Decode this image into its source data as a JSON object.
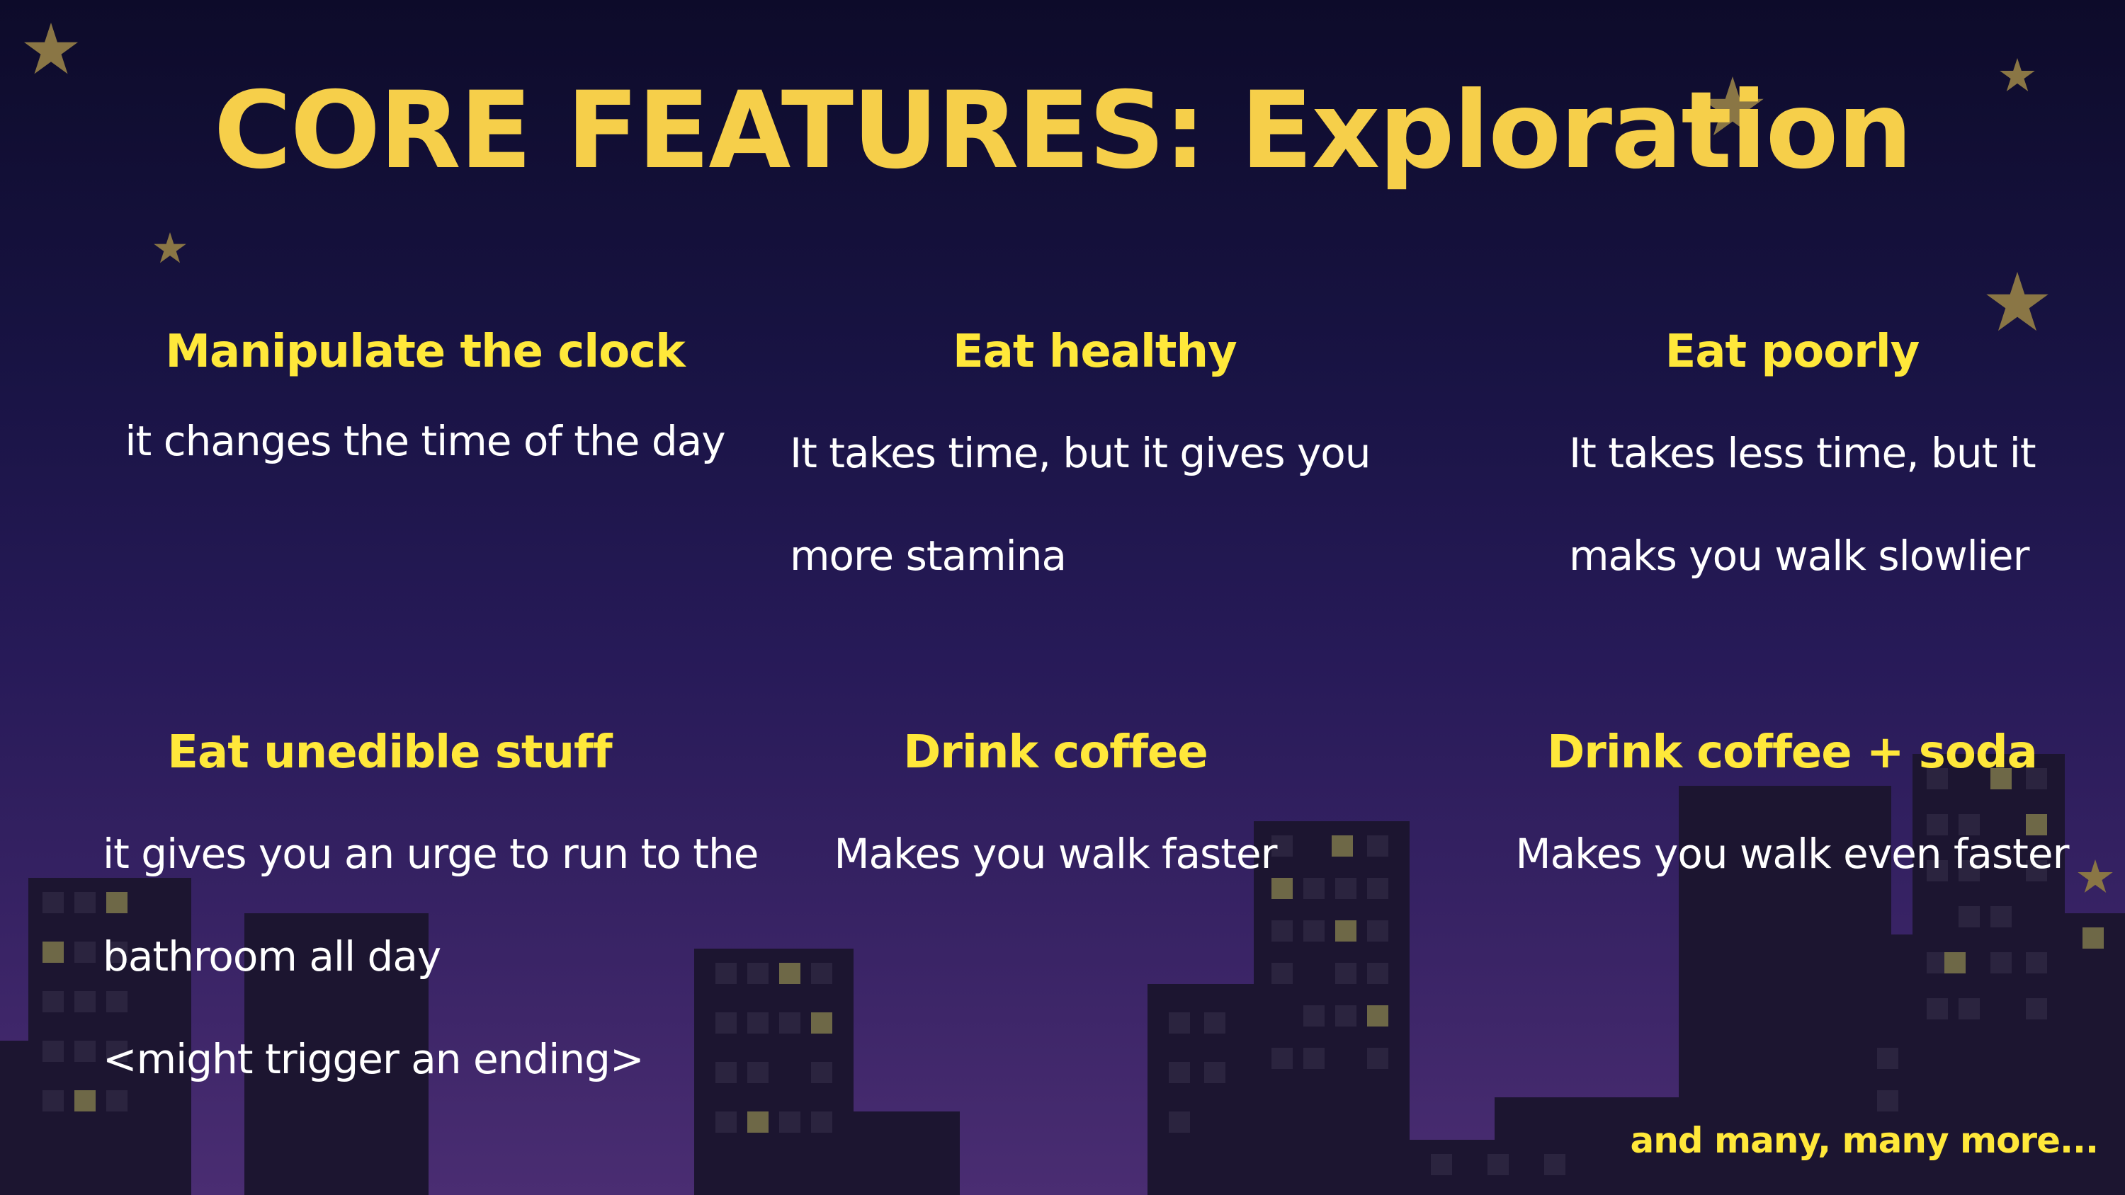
{
  "title": "CORE FEATURES: Exploration",
  "features": [
    {
      "heading": "Manipulate the clock",
      "lines": [
        "it changes the time of the day"
      ]
    },
    {
      "heading": "Eat healthy",
      "lines": [
        "It takes time, but it gives you",
        "more stamina"
      ]
    },
    {
      "heading": "Eat poorly",
      "lines": [
        "It takes less time, but it",
        "maks you walk slowlier"
      ]
    },
    {
      "heading": "Eat unedible stuff",
      "lines": [
        "it gives you an urge to run to the",
        "bathroom all day",
        "<might trigger an ending>"
      ]
    },
    {
      "heading": "Drink coffee",
      "lines": [
        "Makes you walk faster"
      ]
    },
    {
      "heading": "Drink coffee + soda",
      "lines": [
        "Makes you walk even faster"
      ]
    }
  ],
  "footer": "and many, many more...",
  "colors": {
    "title": "#f6cf4a",
    "heading": "#ffe83a",
    "body_text": "#ffffff",
    "star": "#8a7645",
    "building": "#1c1530",
    "window_lit": "#6e6847",
    "window_dark": "#2b243f"
  },
  "icons": [
    "star-icon",
    "city-skyline"
  ]
}
